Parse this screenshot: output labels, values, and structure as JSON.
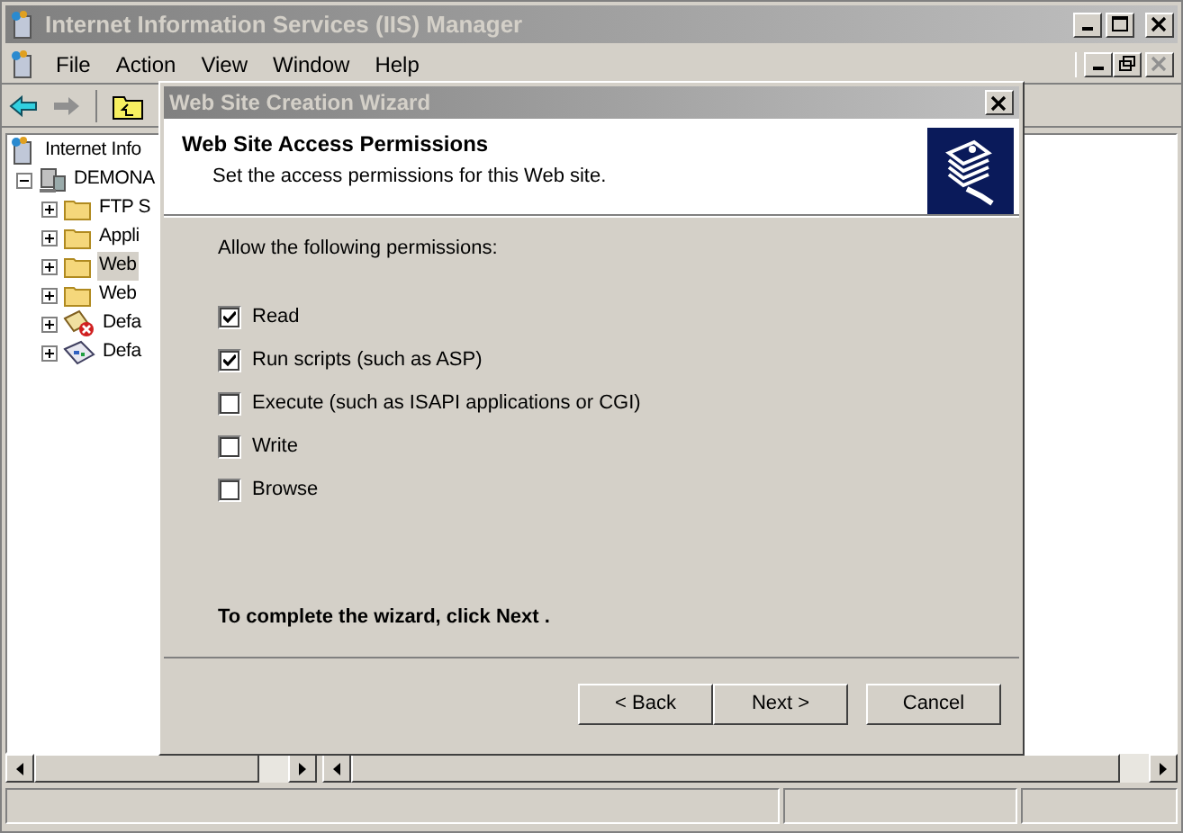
{
  "window": {
    "title": "Internet Information Services (IIS) Manager"
  },
  "menu": [
    "File",
    "Action",
    "View",
    "Window",
    "Help"
  ],
  "tree": [
    {
      "label": "Internet Info",
      "kind": "services",
      "children": [
        {
          "label": "DEMONA",
          "kind": "server",
          "expanded": true,
          "selected": false,
          "children": [
            {
              "label": "FTP S",
              "kind": "folder",
              "expanded": false,
              "selected": false
            },
            {
              "label": "Appli",
              "kind": "folder",
              "expanded": false,
              "selected": false
            },
            {
              "label": "Web",
              "kind": "folder",
              "expanded": false,
              "selected": true
            },
            {
              "label": "Web",
              "kind": "folder",
              "expanded": false,
              "selected": false
            },
            {
              "label": "Defa",
              "kind": "stopped-site",
              "expanded": false,
              "selected": false
            },
            {
              "label": "Defa",
              "kind": "site",
              "expanded": false,
              "selected": false
            }
          ]
        }
      ]
    }
  ],
  "dialog": {
    "title": "Web Site Creation Wizard",
    "header": {
      "title": "Web Site Access Permissions",
      "subtitle": "Set the access permissions for this Web site."
    },
    "prompt": "Allow the following permissions:",
    "permissions": [
      {
        "label": "Read",
        "checked": true
      },
      {
        "label": "Run scripts (such as ASP)",
        "checked": true
      },
      {
        "label": "Execute (such as ISAPI applications or CGI)",
        "checked": false
      },
      {
        "label": "Write",
        "checked": false
      },
      {
        "label": "Browse",
        "checked": false
      }
    ],
    "footer_text": "To complete the wizard, click Next .",
    "buttons": [
      "< Back",
      "Next >",
      "Cancel"
    ]
  }
}
